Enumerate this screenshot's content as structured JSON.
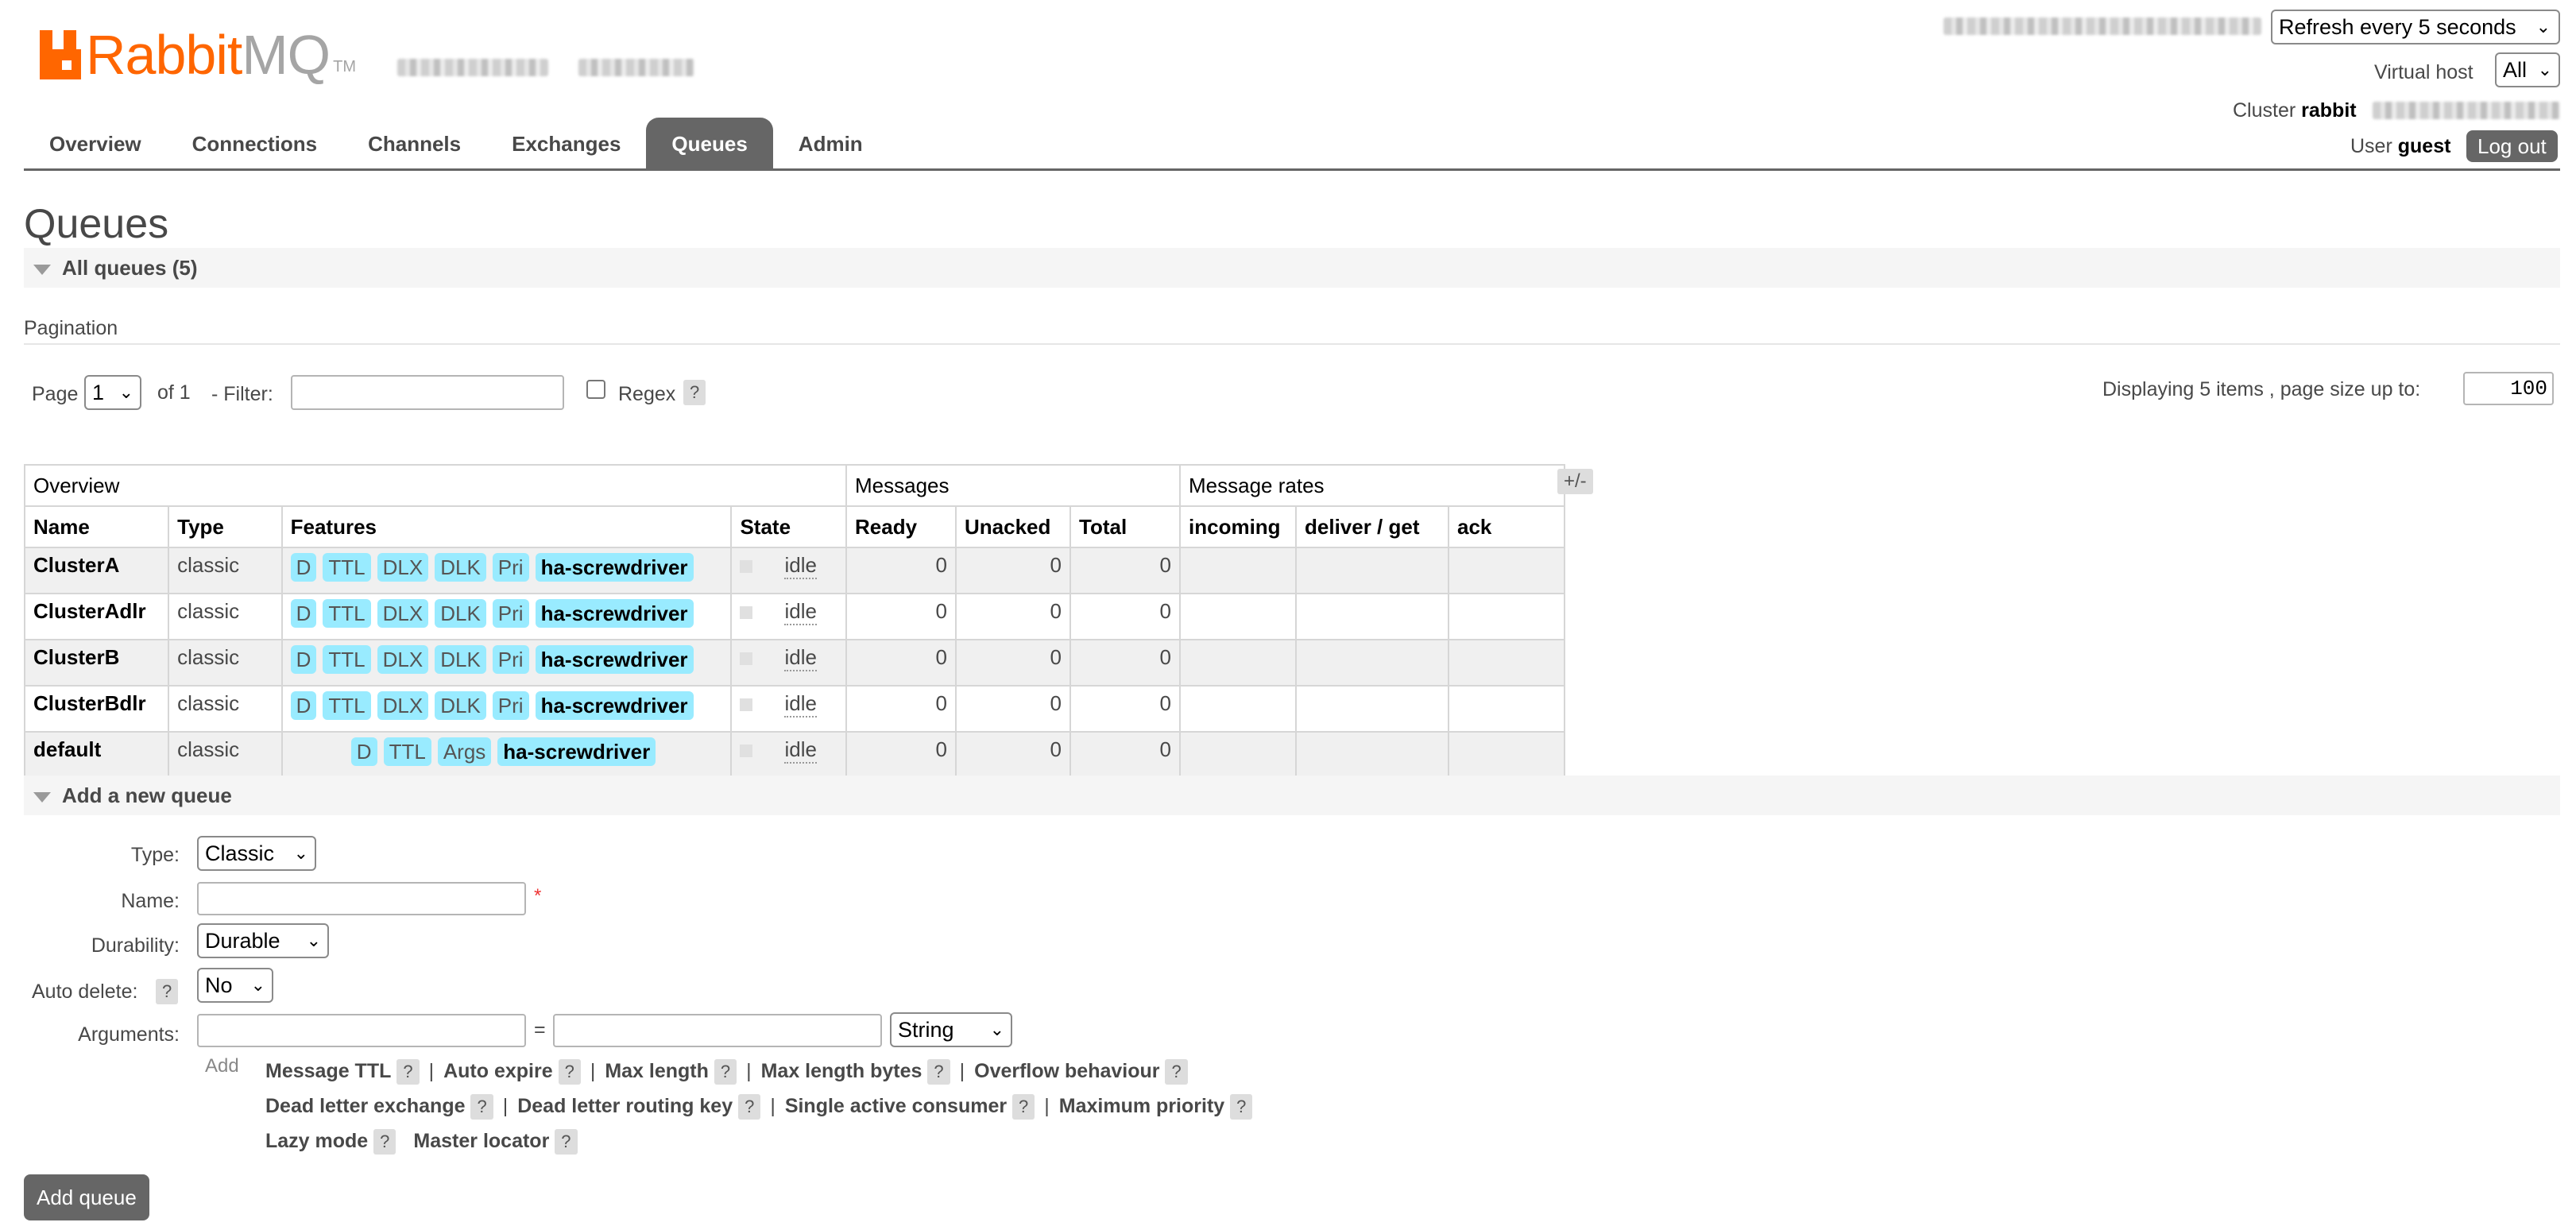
{
  "header": {
    "logo_word_1": "Rabbit",
    "logo_word_2": "MQ",
    "logo_tm": "TM",
    "refresh_option": "Refresh every 5 seconds",
    "virtual_host_label": "Virtual host",
    "virtual_host_value": "All",
    "cluster_label": "Cluster",
    "cluster_name": "rabbit",
    "user_label": "User",
    "user_name": "guest",
    "logout_label": "Log out"
  },
  "tabs": [
    {
      "label": "Overview"
    },
    {
      "label": "Connections"
    },
    {
      "label": "Channels"
    },
    {
      "label": "Exchanges"
    },
    {
      "label": "Queues",
      "active": true
    },
    {
      "label": "Admin"
    }
  ],
  "page_title": "Queues",
  "all_queues_label": "All queues (5)",
  "pagination": {
    "label": "Pagination",
    "page_label": "Page",
    "page_value": "1",
    "of_label": "of 1",
    "filter_label": "- Filter:",
    "filter_value": "",
    "regex_label": "Regex",
    "help": "?",
    "displaying": "Displaying 5 items , page size up to:",
    "page_size": "100"
  },
  "table": {
    "groups": [
      "Overview",
      "Messages",
      "Message rates"
    ],
    "plus_minus": "+/-",
    "columns": [
      "Name",
      "Type",
      "Features",
      "State",
      "Ready",
      "Unacked",
      "Total",
      "incoming",
      "deliver / get",
      "ack"
    ],
    "rows": [
      {
        "name": "ClusterA",
        "type": "classic",
        "features": [
          "D",
          "TTL",
          "DLX",
          "DLK",
          "Pri"
        ],
        "policy": "ha-screwdriver",
        "state": "idle",
        "ready": "0",
        "unacked": "0",
        "total": "0"
      },
      {
        "name": "ClusterAdlr",
        "type": "classic",
        "features": [
          "D",
          "TTL",
          "DLX",
          "DLK",
          "Pri"
        ],
        "policy": "ha-screwdriver",
        "state": "idle",
        "ready": "0",
        "unacked": "0",
        "total": "0"
      },
      {
        "name": "ClusterB",
        "type": "classic",
        "features": [
          "D",
          "TTL",
          "DLX",
          "DLK",
          "Pri"
        ],
        "policy": "ha-screwdriver",
        "state": "idle",
        "ready": "0",
        "unacked": "0",
        "total": "0"
      },
      {
        "name": "ClusterBdlr",
        "type": "classic",
        "features": [
          "D",
          "TTL",
          "DLX",
          "DLK",
          "Pri"
        ],
        "policy": "ha-screwdriver",
        "state": "idle",
        "ready": "0",
        "unacked": "0",
        "total": "0"
      },
      {
        "name": "default",
        "type": "classic",
        "features": [
          "D",
          "TTL",
          "Args"
        ],
        "policy": "ha-screwdriver",
        "state": "idle",
        "ready": "0",
        "unacked": "0",
        "total": "0"
      }
    ]
  },
  "add_queue": {
    "section_label": "Add a new queue",
    "type_label": "Type:",
    "type_value": "Classic",
    "name_label": "Name:",
    "required_mark": "*",
    "durability_label": "Durability:",
    "durability_value": "Durable",
    "auto_delete_label": "Auto delete:",
    "auto_delete_value": "No",
    "arguments_label": "Arguments:",
    "equals": "=",
    "arg_type_value": "String",
    "add_label": "Add",
    "arg_links": [
      [
        "Message TTL",
        "Auto expire",
        "Max length",
        "Max length bytes",
        "Overflow behaviour"
      ],
      [
        "Dead letter exchange",
        "Dead letter routing key",
        "Single active consumer",
        "Maximum priority"
      ],
      [
        "Lazy mode",
        "Master locator"
      ]
    ],
    "submit_label": "Add queue"
  },
  "colors": {
    "brand_orange": "#ff6600",
    "tab_active": "#666666",
    "feature_badge": "#99ebff"
  }
}
